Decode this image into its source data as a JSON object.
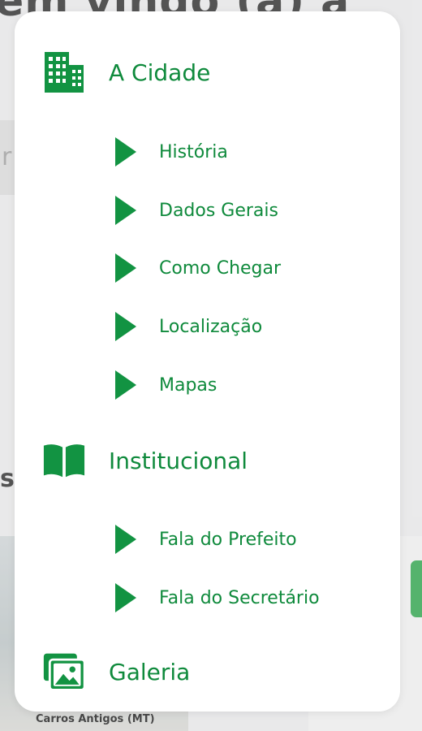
{
  "background": {
    "heading": "em vindo (a) a",
    "search_fragment": "r",
    "section_fragment": "s",
    "photo_caption": "Carros Antigos (MT)"
  },
  "menu": {
    "accent_color": "#0f8a3c",
    "sections": [
      {
        "label": "A Cidade",
        "icon": "buildings-icon",
        "items": [
          "História",
          "Dados Gerais",
          "Como Chegar",
          "Localização",
          "Mapas"
        ]
      },
      {
        "label": "Institucional",
        "icon": "book-icon",
        "items": [
          "Fala do Prefeito",
          "Fala do Secretário"
        ]
      },
      {
        "label": "Galeria",
        "icon": "gallery-icon",
        "items": []
      }
    ]
  }
}
